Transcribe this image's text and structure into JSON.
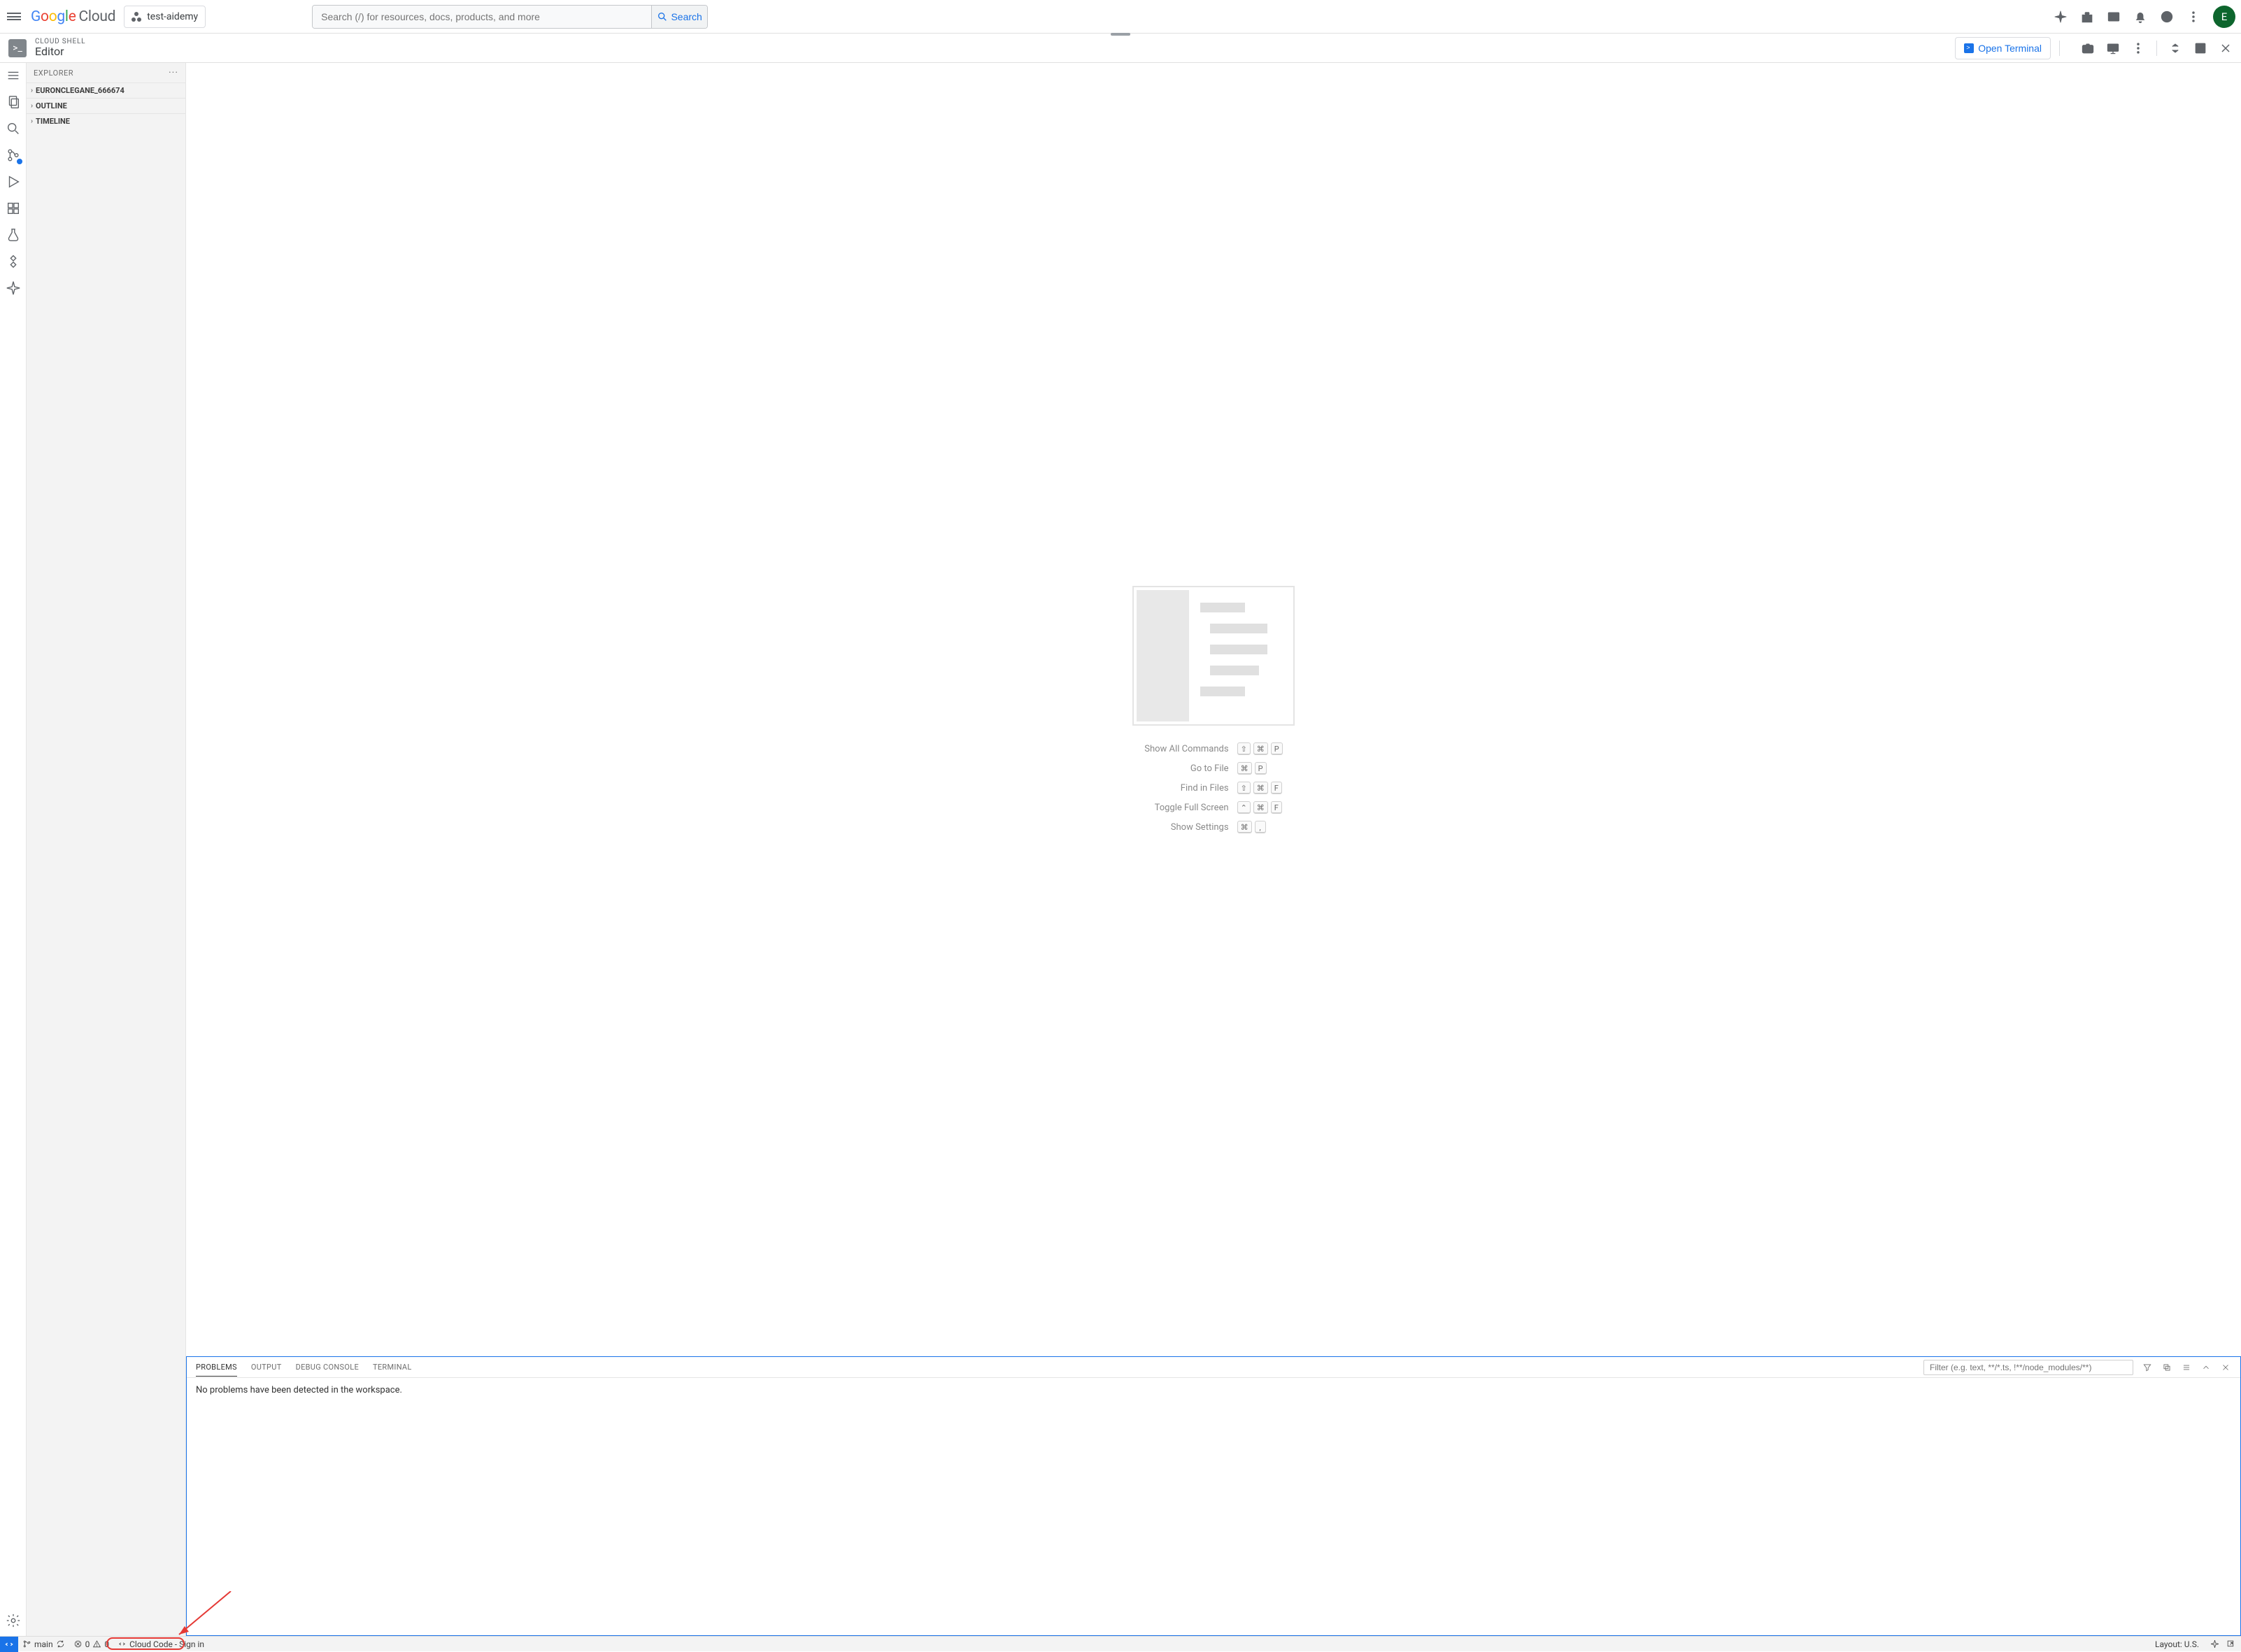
{
  "header": {
    "logo_cloud": "Cloud",
    "project": "test-aidemy",
    "search_placeholder": "Search (/) for resources, docs, products, and more",
    "search_button": "Search",
    "avatar_initial": "E"
  },
  "sub_header": {
    "label_small": "CLOUD SHELL",
    "label_big": "Editor",
    "open_terminal": "Open Terminal"
  },
  "explorer": {
    "title": "EXPLORER",
    "sections": [
      "EURONCLEGANE_666674",
      "OUTLINE",
      "TIMELINE"
    ]
  },
  "welcome_hints": [
    {
      "label": "Show All Commands",
      "keys": [
        "⇧",
        "⌘",
        "P"
      ]
    },
    {
      "label": "Go to File",
      "keys": [
        "⌘",
        "P"
      ]
    },
    {
      "label": "Find in Files",
      "keys": [
        "⇧",
        "⌘",
        "F"
      ]
    },
    {
      "label": "Toggle Full Screen",
      "keys": [
        "⌃",
        "⌘",
        "F"
      ]
    },
    {
      "label": "Show Settings",
      "keys": [
        "⌘",
        ","
      ]
    }
  ],
  "panel": {
    "tabs": [
      "PROBLEMS",
      "OUTPUT",
      "DEBUG CONSOLE",
      "TERMINAL"
    ],
    "active_tab": 0,
    "filter_placeholder": "Filter (e.g. text, **/*.ts, !**/node_modules/**)",
    "body_text": "No problems have been detected in the workspace."
  },
  "status": {
    "branch": "main",
    "errors": "0",
    "warnings": "0",
    "cloud_code": "Cloud Code - Sign in",
    "layout": "Layout: U.S."
  }
}
